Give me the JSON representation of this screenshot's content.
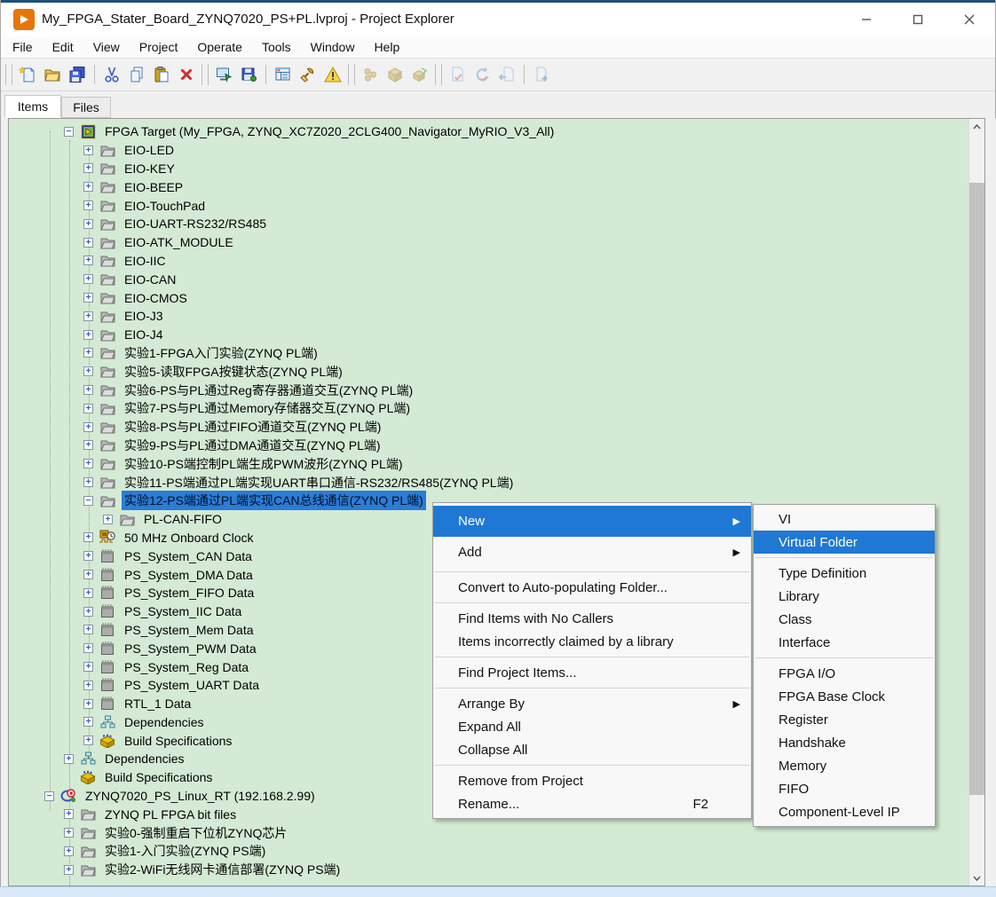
{
  "window": {
    "title": "My_FPGA_Stater_Board_ZYNQ7020_PS+PL.lvproj - Project Explorer",
    "app_icon": "labview-icon",
    "controls": [
      {
        "name": "minimize-button",
        "icon": "minimize-icon"
      },
      {
        "name": "maximize-button",
        "icon": "maximize-icon"
      },
      {
        "name": "close-button",
        "icon": "close-icon"
      }
    ]
  },
  "menu_bar": {
    "items": [
      "File",
      "Edit",
      "View",
      "Project",
      "Operate",
      "Tools",
      "Window",
      "Help"
    ]
  },
  "toolbar": {
    "groups": [
      {
        "sep": "grip",
        "items": [
          "new-vi-icon",
          "open-project-icon",
          "save-all-icon"
        ]
      },
      {
        "sep": "line",
        "items": [
          "cut-icon",
          "copy-icon",
          "paste-icon",
          "delete-icon"
        ]
      },
      {
        "sep": "grip",
        "items": [
          "target-settings-icon",
          "save-target-icon"
        ]
      },
      {
        "sep": "line",
        "items": [
          "view-grid-icon",
          "tools-icon",
          "warning-icon"
        ]
      },
      {
        "sep": "grip",
        "items": [
          "build-icon",
          "deploy-icon",
          "run-build-icon"
        ],
        "dim": true
      },
      {
        "sep": "grip",
        "items": [
          "sc-checkin-icon",
          "sc-undo-icon",
          "sc-get-icon"
        ],
        "dim": true
      },
      {
        "sep": "line",
        "items": [
          "sc-add-icon"
        ],
        "dim": true
      }
    ]
  },
  "tabs": {
    "items": [
      {
        "label": "Items",
        "selected": true
      },
      {
        "label": "Files",
        "selected": false
      }
    ]
  },
  "tree": {
    "items": [
      {
        "level": 1,
        "expander": "minus",
        "icon": "fpga-target-icon",
        "label": "FPGA Target (My_FPGA, ZYNQ_XC7Z020_2CLG400_Navigator_MyRIO_V3_All)"
      },
      {
        "level": 2,
        "expander": "plus",
        "icon": "virtual-folder-icon",
        "label": "EIO-LED"
      },
      {
        "level": 2,
        "expander": "plus",
        "icon": "virtual-folder-icon",
        "label": "EIO-KEY"
      },
      {
        "level": 2,
        "expander": "plus",
        "icon": "virtual-folder-icon",
        "label": "EIO-BEEP"
      },
      {
        "level": 2,
        "expander": "plus",
        "icon": "virtual-folder-icon",
        "label": "EIO-TouchPad"
      },
      {
        "level": 2,
        "expander": "plus",
        "icon": "virtual-folder-icon",
        "label": "EIO-UART-RS232/RS485"
      },
      {
        "level": 2,
        "expander": "plus",
        "icon": "virtual-folder-icon",
        "label": "EIO-ATK_MODULE"
      },
      {
        "level": 2,
        "expander": "plus",
        "icon": "virtual-folder-icon",
        "label": "EIO-IIC"
      },
      {
        "level": 2,
        "expander": "plus",
        "icon": "virtual-folder-icon",
        "label": "EIO-CAN"
      },
      {
        "level": 2,
        "expander": "plus",
        "icon": "virtual-folder-icon",
        "label": "EIO-CMOS"
      },
      {
        "level": 2,
        "expander": "plus",
        "icon": "virtual-folder-icon",
        "label": "EIO-J3"
      },
      {
        "level": 2,
        "expander": "plus",
        "icon": "virtual-folder-icon",
        "label": "EIO-J4"
      },
      {
        "level": 2,
        "expander": "plus",
        "icon": "virtual-folder-icon",
        "label": "实验1-FPGA入门实验(ZYNQ PL端)"
      },
      {
        "level": 2,
        "expander": "plus",
        "icon": "virtual-folder-icon",
        "label": "实验5-读取FPGA按键状态(ZYNQ PL端)"
      },
      {
        "level": 2,
        "expander": "plus",
        "icon": "virtual-folder-icon",
        "label": "实验6-PS与PL通过Reg寄存器通道交互(ZYNQ PL端)"
      },
      {
        "level": 2,
        "expander": "plus",
        "icon": "virtual-folder-icon",
        "label": "实验7-PS与PL通过Memory存储器交互(ZYNQ PL端)"
      },
      {
        "level": 2,
        "expander": "plus",
        "icon": "virtual-folder-icon",
        "label": "实验8-PS与PL通过FIFO通道交互(ZYNQ PL端)"
      },
      {
        "level": 2,
        "expander": "plus",
        "icon": "virtual-folder-icon",
        "label": "实验9-PS与PL通过DMA通道交互(ZYNQ PL端)"
      },
      {
        "level": 2,
        "expander": "plus",
        "icon": "virtual-folder-icon",
        "label": "实验10-PS端控制PL端生成PWM波形(ZYNQ PL端)"
      },
      {
        "level": 2,
        "expander": "plus",
        "icon": "virtual-folder-icon",
        "label": "实验11-PS端通过PL端实现UART串口通信-RS232/RS485(ZYNQ PL端)"
      },
      {
        "level": 2,
        "expander": "minus",
        "icon": "virtual-folder-icon",
        "label": "实验12-PS端通过PL端实现CAN总线通信(ZYNQ PL端)",
        "selected": true
      },
      {
        "level": 3,
        "expander": "plus",
        "icon": "virtual-folder-icon",
        "label": "PL-CAN-FIFO"
      },
      {
        "level": 2,
        "expander": "plus",
        "icon": "onboard-clock-icon",
        "label": "50 MHz Onboard Clock"
      },
      {
        "level": 2,
        "expander": "plus",
        "icon": "ip-chip-icon",
        "label": "PS_System_CAN Data"
      },
      {
        "level": 2,
        "expander": "plus",
        "icon": "ip-chip-icon",
        "label": "PS_System_DMA Data"
      },
      {
        "level": 2,
        "expander": "plus",
        "icon": "ip-chip-icon",
        "label": "PS_System_FIFO Data"
      },
      {
        "level": 2,
        "expander": "plus",
        "icon": "ip-chip-icon",
        "label": "PS_System_IIC Data"
      },
      {
        "level": 2,
        "expander": "plus",
        "icon": "ip-chip-icon",
        "label": "PS_System_Mem Data"
      },
      {
        "level": 2,
        "expander": "plus",
        "icon": "ip-chip-icon",
        "label": "PS_System_PWM Data"
      },
      {
        "level": 2,
        "expander": "plus",
        "icon": "ip-chip-icon",
        "label": "PS_System_Reg Data"
      },
      {
        "level": 2,
        "expander": "plus",
        "icon": "ip-chip-icon",
        "label": "PS_System_UART Data"
      },
      {
        "level": 2,
        "expander": "plus",
        "icon": "ip-chip-icon",
        "label": "RTL_1 Data"
      },
      {
        "level": 2,
        "expander": "plus",
        "icon": "dependencies-icon",
        "label": "Dependencies"
      },
      {
        "level": 2,
        "expander": "plus",
        "icon": "build-specifications-icon",
        "label": "Build Specifications"
      },
      {
        "level": 1,
        "expander": "plus",
        "icon": "dependencies-icon",
        "label": "Dependencies"
      },
      {
        "level": 1,
        "expander": "none",
        "icon": "build-specifications-icon",
        "label": "Build Specifications"
      },
      {
        "level": 0,
        "expander": "minus",
        "icon": "rt-target-icon",
        "label": "ZYNQ7020_PS_Linux_RT (192.168.2.99)"
      },
      {
        "level": 1,
        "expander": "plus",
        "icon": "virtual-folder-icon",
        "label": "ZYNQ PL FPGA bit files"
      },
      {
        "level": 1,
        "expander": "plus",
        "icon": "virtual-folder-icon",
        "label": "实验0-强制重启下位机ZYNQ芯片"
      },
      {
        "level": 1,
        "expander": "plus",
        "icon": "virtual-folder-icon",
        "label": "实验1-入门实验(ZYNQ PS端)"
      },
      {
        "level": 1,
        "expander": "plus",
        "icon": "virtual-folder-icon",
        "label": "实验2-WiFi无线网卡通信部署(ZYNQ PS端)"
      }
    ]
  },
  "context_menu": {
    "items": [
      {
        "label": "New",
        "arrow": true,
        "highlighted": true,
        "tall": true
      },
      {
        "label": "Add",
        "arrow": true,
        "tall": true
      },
      {
        "type": "separator"
      },
      {
        "label": "Convert to Auto-populating Folder..."
      },
      {
        "type": "separator"
      },
      {
        "label": "Find Items with No Callers"
      },
      {
        "label": "Items incorrectly claimed by a library"
      },
      {
        "type": "separator"
      },
      {
        "label": "Find Project Items..."
      },
      {
        "type": "separator"
      },
      {
        "label": "Arrange By",
        "arrow": true
      },
      {
        "label": "Expand All"
      },
      {
        "label": "Collapse All"
      },
      {
        "type": "separator"
      },
      {
        "label": "Remove from Project"
      },
      {
        "label": "Rename...",
        "shortcut": "F2"
      }
    ]
  },
  "submenu": {
    "items": [
      {
        "label": "VI"
      },
      {
        "label": "Virtual Folder",
        "highlighted": true
      },
      {
        "type": "separator"
      },
      {
        "label": "Type Definition"
      },
      {
        "label": "Library"
      },
      {
        "label": "Class"
      },
      {
        "label": "Interface"
      },
      {
        "type": "separator"
      },
      {
        "label": "FPGA I/O"
      },
      {
        "label": "FPGA Base Clock"
      },
      {
        "label": "Register"
      },
      {
        "label": "Handshake"
      },
      {
        "label": "Memory"
      },
      {
        "label": "FIFO"
      },
      {
        "label": "Component-Level IP"
      }
    ]
  },
  "colors": {
    "tree_background": "#d4ead4",
    "selection_blue": "#2a7cd8",
    "menu_highlight": "#1f78d4",
    "chrome_background": "#f0f0f0",
    "titlebar_top_border": "#1f4e79",
    "app_brand_orange": "#e8740c",
    "bottom_strip": "#d9e9f9"
  }
}
